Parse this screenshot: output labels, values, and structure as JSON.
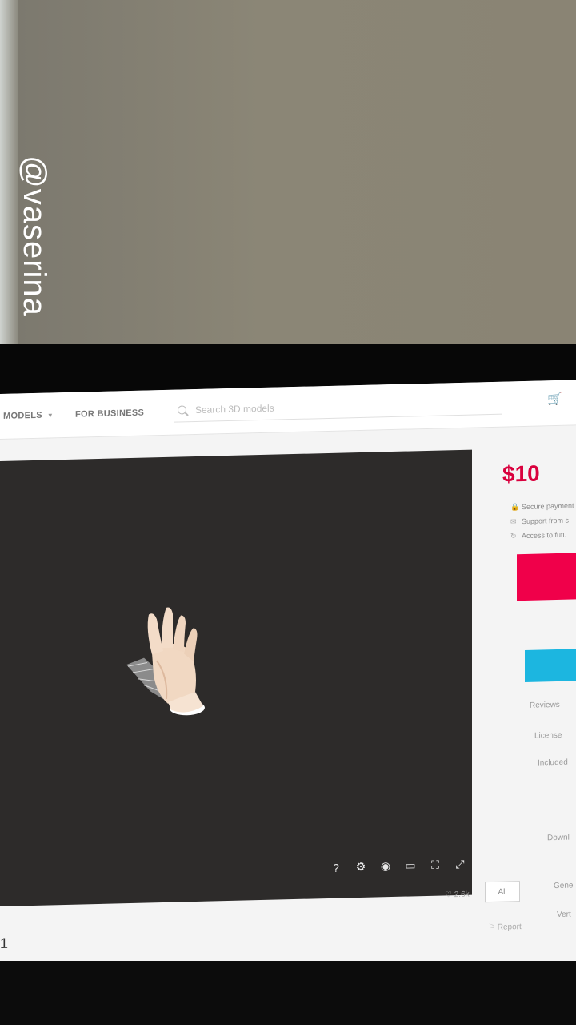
{
  "watermark": "@vaserina",
  "nav": {
    "models": "MODELS",
    "business": "FOR BUSINESS",
    "search_placeholder": "Search 3D models",
    "cart_icon": "cart-icon"
  },
  "viewer": {
    "tools": [
      "?",
      "⚙",
      "◉",
      "▭",
      "⛶",
      "⤢"
    ],
    "tool_icons": [
      "help-icon",
      "settings-icon",
      "vr-icon",
      "vr-glasses-icon",
      "inspector-icon",
      "fullscreen-icon"
    ]
  },
  "panel": {
    "price": "$10",
    "features": [
      "Secure payment",
      "Support from s",
      "Access to futu"
    ],
    "labels": [
      "Reviews",
      "License",
      "Included",
      "Downl",
      "Gene",
      "Vert"
    ]
  },
  "below": {
    "likes": "2.6k",
    "all_label": "All",
    "report": "Report",
    "title_fragment": "1"
  },
  "colors": {
    "accent": "#d9003d",
    "buy_button": "#f0004a",
    "secondary_button": "#1cb6e0",
    "viewer_bg": "#2d2b2a"
  }
}
